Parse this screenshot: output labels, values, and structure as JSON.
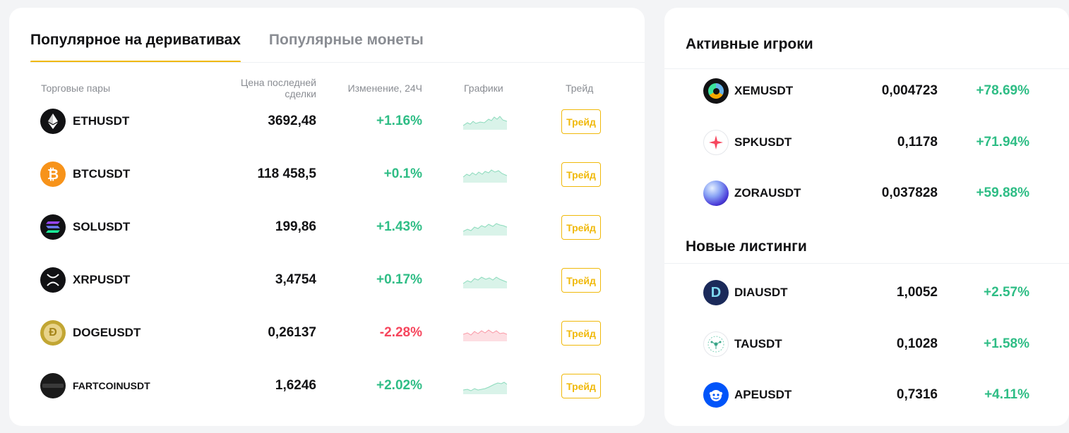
{
  "tabs": [
    {
      "label": "Популярное на деривативах",
      "active": true
    },
    {
      "label": "Популярные монеты",
      "active": false
    }
  ],
  "table_headers": {
    "pair": "Торговые пары",
    "price_line1": "Цена последней",
    "price_line2": "сделки",
    "change": "Изменение, 24Ч",
    "chart": "Графики",
    "trade": "Трейд"
  },
  "rows": [
    {
      "pair": "ETHUSDT",
      "price": "3692,48",
      "change": "+1.16%",
      "trend": "up",
      "icon": "ethereum-icon",
      "trade": "Трейд"
    },
    {
      "pair": "BTCUSDT",
      "price": "118 458,5",
      "change": "+0.1%",
      "trend": "up",
      "icon": "bitcoin-icon",
      "trade": "Трейд"
    },
    {
      "pair": "SOLUSDT",
      "price": "199,86",
      "change": "+1.43%",
      "trend": "up",
      "icon": "solana-icon",
      "trade": "Трейд"
    },
    {
      "pair": "XRPUSDT",
      "price": "3,4754",
      "change": "+0.17%",
      "trend": "up",
      "icon": "xrp-icon",
      "trade": "Трейд"
    },
    {
      "pair": "DOGEUSDT",
      "price": "0,26137",
      "change": "-2.28%",
      "trend": "down",
      "icon": "dogecoin-icon",
      "trade": "Трейд"
    },
    {
      "pair": "FARTCOINUSDT",
      "price": "1,6246",
      "change": "+2.02%",
      "trend": "up",
      "icon": "fartcoin-icon",
      "trade": "Трейд"
    }
  ],
  "active_players": {
    "title": "Активные игроки",
    "items": [
      {
        "pair": "XEMUSDT",
        "price": "0,004723",
        "change": "+78.69%",
        "icon": "nem-icon"
      },
      {
        "pair": "SPKUSDT",
        "price": "0,1178",
        "change": "+71.94%",
        "icon": "spark-icon"
      },
      {
        "pair": "ZORAUSDT",
        "price": "0,037828",
        "change": "+59.88%",
        "icon": "zora-icon"
      }
    ]
  },
  "new_listings": {
    "title": "Новые листинги",
    "items": [
      {
        "pair": "DIAUSDT",
        "price": "1,0052",
        "change": "+2.57%",
        "icon": "dia-icon"
      },
      {
        "pair": "TAUSDT",
        "price": "0,1028",
        "change": "+1.58%",
        "icon": "tau-icon"
      },
      {
        "pair": "APEUSDT",
        "price": "0,7316",
        "change": "+4.11%",
        "icon": "apecoin-icon"
      }
    ]
  },
  "colors": {
    "accent": "#f0b90b",
    "up": "#2ebd85",
    "down": "#f6465d"
  }
}
